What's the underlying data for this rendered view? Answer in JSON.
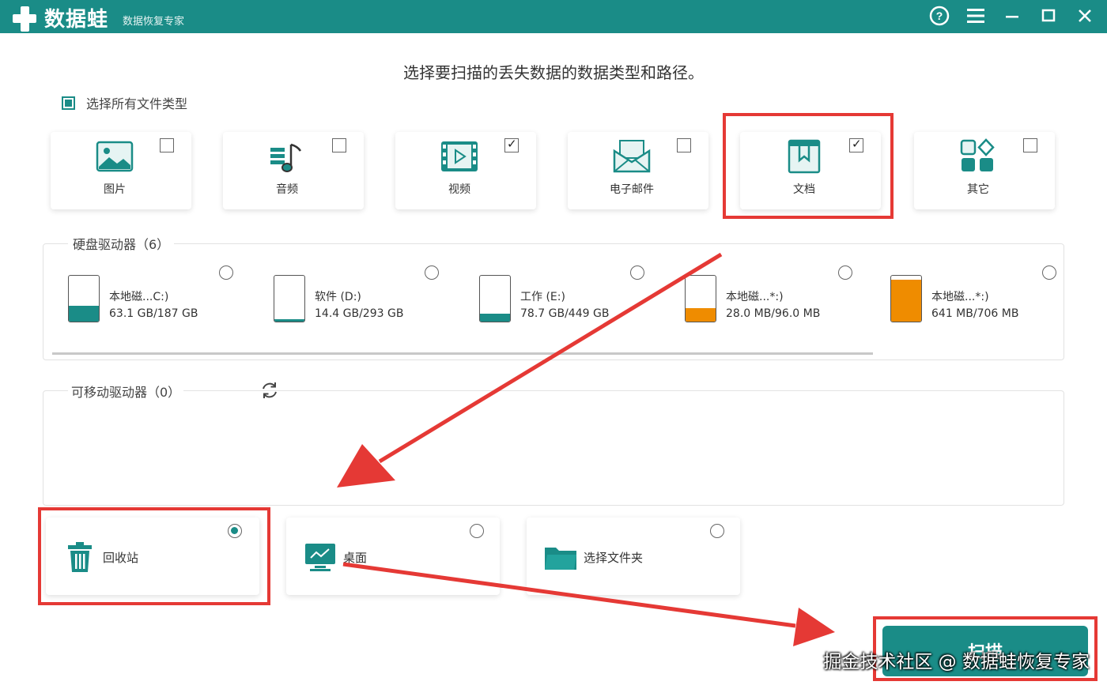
{
  "app": {
    "name": "数据蛙",
    "subtitle": "数据恢复专家"
  },
  "heading": "选择要扫描的丢失数据的数据类型和路径。",
  "select_all": {
    "label": "选择所有文件类型",
    "checked": true
  },
  "file_types": [
    {
      "label": "图片",
      "icon": "image-icon",
      "checked": false
    },
    {
      "label": "音频",
      "icon": "audio-icon",
      "checked": false
    },
    {
      "label": "视频",
      "icon": "video-icon",
      "checked": true
    },
    {
      "label": "电子邮件",
      "icon": "email-icon",
      "checked": false
    },
    {
      "label": "文档",
      "icon": "document-icon",
      "checked": true
    },
    {
      "label": "其它",
      "icon": "other-icon",
      "checked": false
    }
  ],
  "hard_drives": {
    "title": "硬盘驱动器（6）",
    "items": [
      {
        "name": "本地磁...C:)",
        "size": "63.1 GB/187 GB",
        "used_fraction": 0.34,
        "fill_color": "#1a8c87"
      },
      {
        "name": "软件 (D:)",
        "size": "14.4 GB/293 GB",
        "used_fraction": 0.05,
        "fill_color": "#1a8c87"
      },
      {
        "name": "工作 (E:)",
        "size": "78.7 GB/449 GB",
        "used_fraction": 0.18,
        "fill_color": "#1a8c87"
      },
      {
        "name": "本地磁...*:)",
        "size": "28.0 MB/96.0 MB",
        "used_fraction": 0.29,
        "fill_color": "#ef8c00"
      },
      {
        "name": "本地磁...*:)",
        "size": "641 MB/706 MB",
        "used_fraction": 0.91,
        "fill_color": "#ef8c00"
      }
    ]
  },
  "removable_drives": {
    "title": "可移动驱动器（0）"
  },
  "locations": [
    {
      "label": "回收站",
      "icon": "recycle-bin-icon",
      "selected": true
    },
    {
      "label": "桌面",
      "icon": "desktop-icon",
      "selected": false
    },
    {
      "label": "选择文件夹",
      "icon": "folder-icon",
      "selected": false
    }
  ],
  "scan_button": "扫描",
  "watermark": "掘金技术社区 @ 数据蛙恢复专家",
  "colors": {
    "accent": "#1a8c87",
    "highlight": "#e53935",
    "drive_low": "#ef8c00"
  }
}
